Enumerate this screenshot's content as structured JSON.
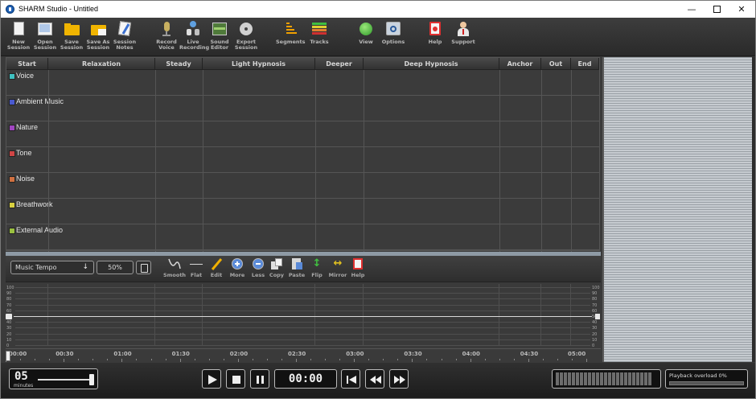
{
  "window": {
    "title": "SHARM Studio - Untitled"
  },
  "toolbar": {
    "new_session": "New\nSession",
    "open_session": "Open\nSession",
    "save_session": "Save\nSession",
    "save_as_session": "Save As\nSession",
    "session_notes": "Session\nNotes",
    "record_voice": "Record\nVoice",
    "live_recording": "Live\nRecording",
    "sound_editor": "Sound\nEditor",
    "export_session": "Export\nSession",
    "segments": "Segments",
    "tracks": "Tracks",
    "view": "View",
    "options": "Options",
    "help": "Help",
    "support": "Support"
  },
  "grid": {
    "columns": [
      "Start",
      "Relaxation",
      "Steady",
      "Light Hypnosis",
      "Deeper",
      "Deep Hypnosis",
      "Anchor",
      "Out",
      "End"
    ],
    "tracks": [
      {
        "name": "Voice",
        "color": "#3fc0c0"
      },
      {
        "name": "Ambient Music",
        "color": "#4a5ad0"
      },
      {
        "name": "Nature",
        "color": "#a045c0"
      },
      {
        "name": "Tone",
        "color": "#d04545"
      },
      {
        "name": "Noise",
        "color": "#d07040"
      },
      {
        "name": "Breathwork",
        "color": "#d8d040"
      },
      {
        "name": "External Audio",
        "color": "#9ac040"
      }
    ]
  },
  "controls": {
    "track_select": "Music Tempo",
    "percent": "50%",
    "smooth": "Smooth",
    "flat": "Flat",
    "edit": "Edit",
    "more": "More",
    "less": "Less",
    "copy": "Copy",
    "paste": "Paste",
    "flip": "Flip",
    "mirror": "Mirror",
    "help": "Help"
  },
  "volume_scale": {
    "ticks": [
      "100",
      "90",
      "80",
      "70",
      "60",
      "50",
      "40",
      "30",
      "20",
      "10",
      "0"
    ],
    "marker": "50"
  },
  "ruler": {
    "labels": [
      "00:00",
      "00:30",
      "01:00",
      "01:30",
      "02:00",
      "02:30",
      "03:00",
      "03:30",
      "04:00",
      "04:30",
      "05:00"
    ]
  },
  "transport": {
    "minutes_value": "05",
    "minutes_unit": "minutes",
    "time": "00:00",
    "overload_label": "Playback overload",
    "overload_value": "0%",
    "overload_fraction": 0.0
  }
}
